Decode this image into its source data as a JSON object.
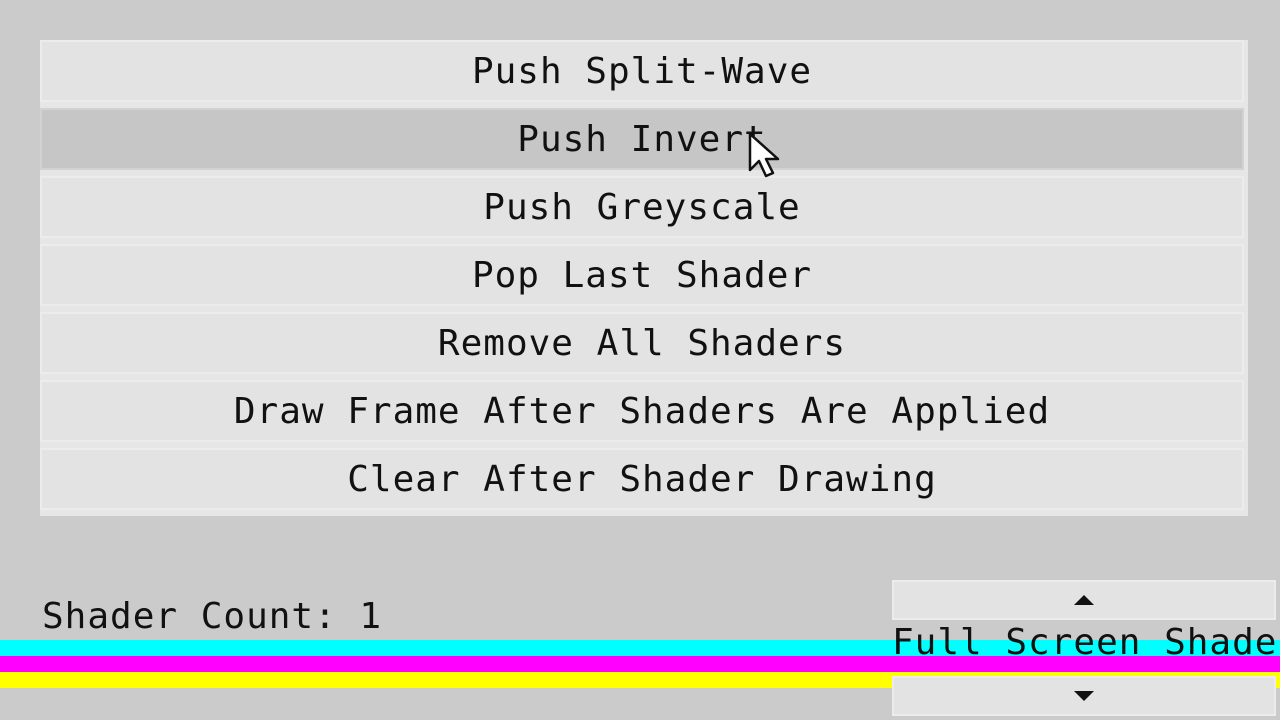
{
  "menu": {
    "buttons": [
      {
        "label": "Push Split-Wave"
      },
      {
        "label": "Push Invert"
      },
      {
        "label": "Push Greyscale"
      },
      {
        "label": "Pop Last Shader"
      },
      {
        "label": "Remove All Shaders"
      },
      {
        "label": "Draw Frame After Shaders Are Applied"
      },
      {
        "label": "Clear After Shader Drawing"
      }
    ],
    "hovered_item": "Push Invert"
  },
  "status": {
    "shader_count_text": "Shader Count: 1"
  },
  "mode_selector": {
    "value": "Full Screen Shader",
    "up_icon": "arrow-up-icon",
    "down_icon": "arrow-down-icon"
  },
  "colors": {
    "background": "#cbcbcb",
    "button": "#e3e3e3",
    "button_hover": "#c6c6c6",
    "stripe_cyan": "#00ffff",
    "stripe_magenta": "#ff00ff",
    "stripe_yellow": "#ffff00"
  }
}
